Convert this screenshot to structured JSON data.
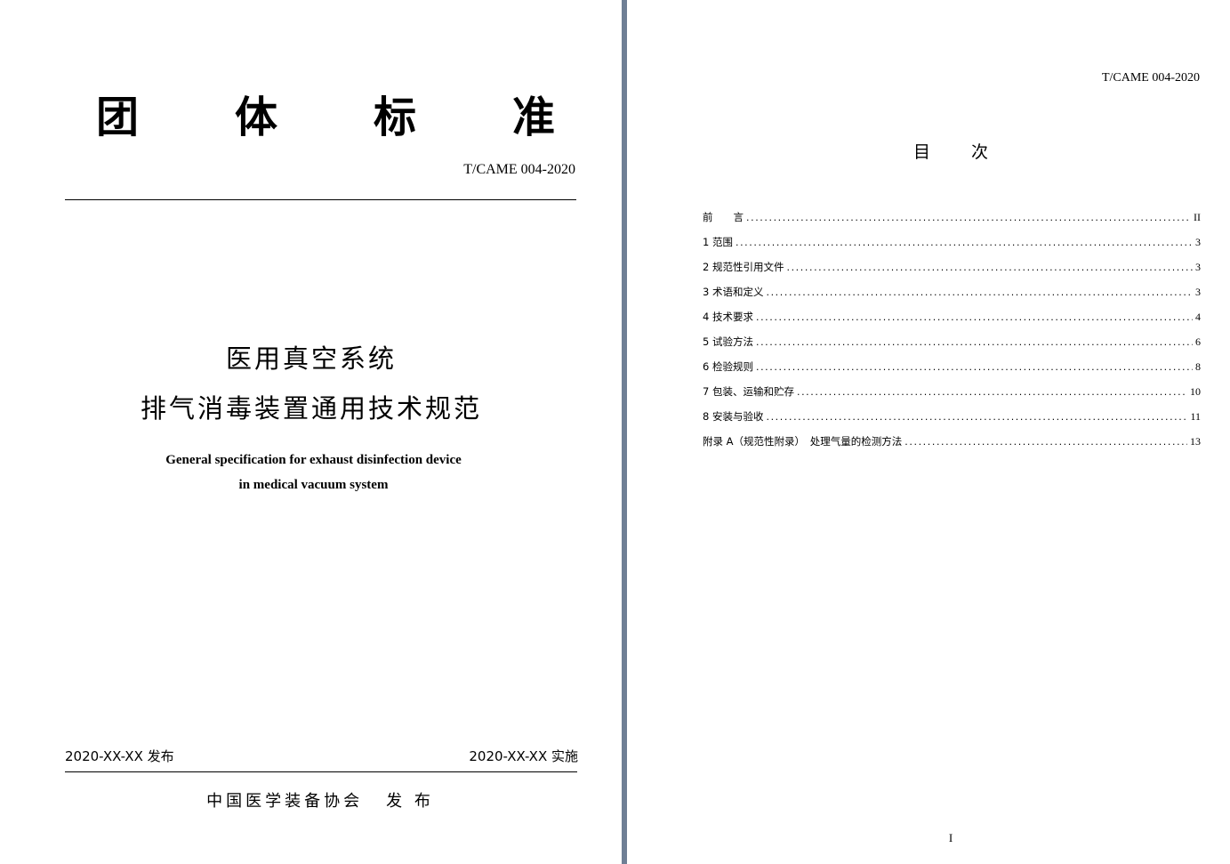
{
  "cover": {
    "title_chars": [
      "团",
      "体",
      "标",
      "准"
    ],
    "standard_no": "T/CAME 004-2020",
    "zh_title_line1": "医用真空系统",
    "zh_title_line2": "排气消毒装置通用技术规范",
    "en_title_line1": "General specification for exhaust disinfection device",
    "en_title_line2": "in medical vacuum system",
    "publish_date": "2020-XX-XX 发布",
    "effective_date": "2020-XX-XX 实施",
    "publisher_name": "中国医学装备协会",
    "publisher_action": "发 布"
  },
  "toc_page": {
    "header_no": "T/CAME 004-2020",
    "title_part1": "目",
    "title_part2": "次",
    "entries": [
      {
        "label": "前　　言",
        "page": "II"
      },
      {
        "label": "1 范围",
        "page": "3"
      },
      {
        "label": "2 规范性引用文件",
        "page": "3"
      },
      {
        "label": "3 术语和定义",
        "page": "3"
      },
      {
        "label": "4 技术要求",
        "page": "4"
      },
      {
        "label": "5 试验方法",
        "page": "6"
      },
      {
        "label": "6 检验规则",
        "page": "8"
      },
      {
        "label": "7 包装、运输和贮存",
        "page": "10"
      },
      {
        "label": "8 安装与验收",
        "page": "11"
      },
      {
        "label": "附录 A（规范性附录）　处理气量的检测方法",
        "page": "13"
      }
    ],
    "page_number": "I"
  },
  "colors": {
    "spine": "#6f7f95",
    "page_bg": "#ffffff",
    "text": "#000000"
  }
}
